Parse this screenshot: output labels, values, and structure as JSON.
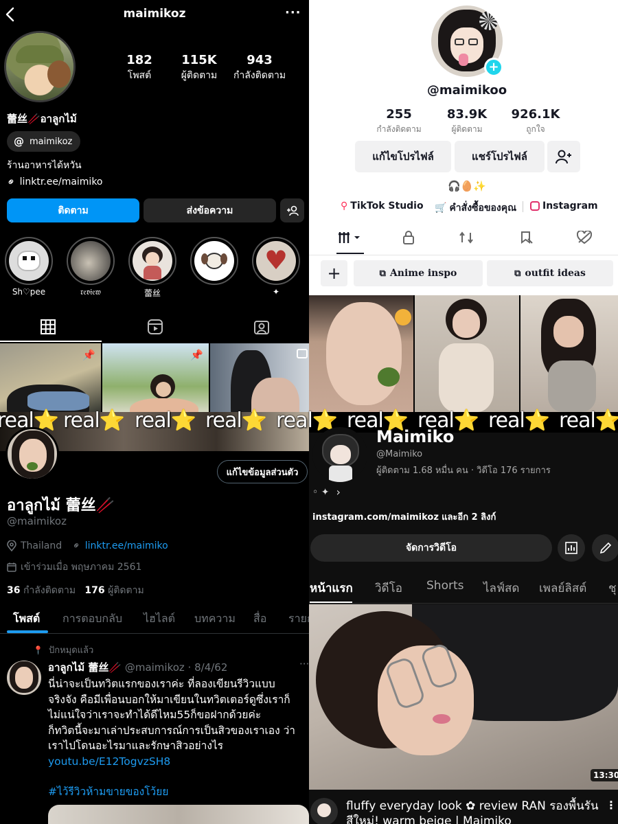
{
  "instagram": {
    "username": "maimikoz",
    "stats": [
      {
        "value": "182",
        "label": "โพสต์"
      },
      {
        "value": "115K",
        "label": "ผู้ติดตาม"
      },
      {
        "value": "943",
        "label": "กำลังติดตาม"
      }
    ],
    "name": "蕾丝🥢อาลูกไม้",
    "threads_handle": "maimikoz",
    "bio": "ร้านอาหารได้หวัน",
    "link": "linktr.ee/maimiko",
    "follow_label": "ติดตาม",
    "message_label": "ส่งข้อความ",
    "highlights": [
      "Sh♡pee",
      "𝔯𝔢𝔳𝔦𝔢𝔴",
      "蕾丝",
      "",
      "✦"
    ],
    "colors": {
      "follow": "#0095f6",
      "secondary": "#262626"
    }
  },
  "tiktok": {
    "username": "@maimikoo",
    "stats": [
      {
        "value": "255",
        "label": "กำลังติดตาม"
      },
      {
        "value": "83.9K",
        "label": "ผู้ติดตาม"
      },
      {
        "value": "926.1K",
        "label": "ถูกใจ"
      }
    ],
    "edit_label": "แก้ไขโปรไฟล์",
    "share_label": "แชร์โปรไฟล์",
    "bio_emoji": "🎧🥚✨",
    "links": [
      "TikTok Studio",
      "คำสั่งซื้อของคุณ",
      "Instagram"
    ],
    "playlists": [
      "Anime inspo",
      "outfit ideas"
    ],
    "colors": {
      "accent": "#fe2c55",
      "plus": "#20d5ec"
    }
  },
  "banner": {
    "word": "real",
    "star": "⭐"
  },
  "x": {
    "name": "อาลูกไม้ 蕾丝🥢",
    "handle": "@maimikoz",
    "edit_label": "แก้ไขข้อมูลส่วนตัว",
    "location": "Thailand",
    "link": "linktr.ee/maimiko",
    "joined": "เข้าร่วมเมื่อ พฤษภาคม 2561",
    "following_count": "36",
    "following_label": "กำลังติดตาม",
    "followers_count": "176",
    "followers_label": "ผู้ติดตาม",
    "tabs": [
      "โพสต์",
      "การตอบกลับ",
      "ไฮไลต์",
      "บทความ",
      "สื่อ",
      "รายก"
    ],
    "pinned_label": "ปักหมุดแล้ว",
    "tweet": {
      "name": "อาลูกไม้ 蕾丝🥢",
      "handle": "@maimikoz",
      "date": "8/4/62",
      "line1": "นี่น่าจะเป็นทวิตแรกของเราค่ะ ที่ลองเขียนรีวิวแบบ",
      "line2": "จริงจัง คือมีเพื่อนบอกให้มาเขียนในทวิตเตอร์ดูซึ่งเราก็",
      "line3": "ไม่แน่ใจว่าเราจะทำได้ดีไหม55ก็ขอฝากด้วยค่ะ",
      "line4": "ก็ทวิตนี้จะมาเล่าประสบการณ์การเป็นสิวของเราเอง ว่า",
      "line5": "เราไปโดนอะไรมาและรักษาสิวอย่างไร",
      "link": "youtu.be/E12TogvzSH8",
      "hashtag": "#ไว้รีวิวห้ามขายของโว้ยย"
    },
    "colors": {
      "link": "#1d9bf0",
      "muted": "#71767b"
    }
  },
  "youtube": {
    "channel_name": "Maimiko",
    "handle": "@Maimiko",
    "meta": "ผู้ติดตาม 1.68 หมื่น คน · วิดีโอ 176 รายการ",
    "desc": "◦ ✦",
    "link": "instagram.com/maimikoz",
    "link_more": "และอีก 2 ลิงก์",
    "manage_label": "จัดการวิดีโอ",
    "tabs": [
      "หน้าแรก",
      "วิดีโอ",
      "Shorts",
      "ไลฟ์สด",
      "เพลย์ลิสต์",
      "ชุ"
    ],
    "video_duration": "13:30",
    "video_title_line1": "fluffy everyday look ✿ review RAN รองพื้นรัน",
    "video_title_line2": "สีใหม่! warm beige | Maimiko"
  }
}
